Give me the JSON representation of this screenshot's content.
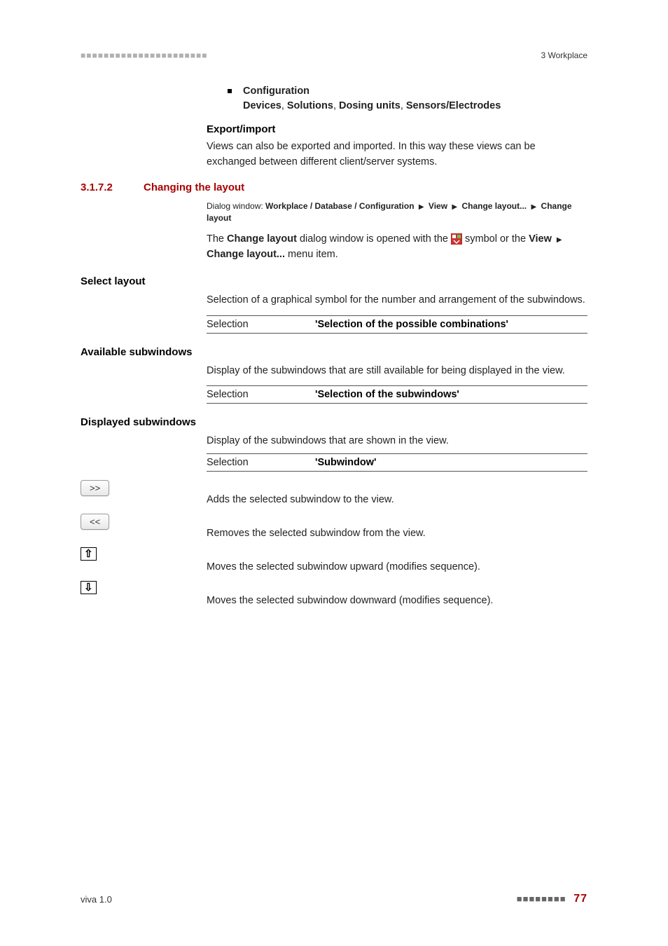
{
  "header": {
    "left_marks": "■■■■■■■■■■■■■■■■■■■■■■",
    "right": "3 Workplace"
  },
  "config_bullet": {
    "title": "Configuration",
    "line2_parts": [
      "Devices",
      "Solutions",
      "Dosing units",
      "Sensors/Electrodes"
    ]
  },
  "export_import": {
    "heading": "Export/import",
    "body": "Views can also be exported and imported. In this way these views can be exchanged between different client/server systems."
  },
  "section": {
    "number": "3.1.7.2",
    "title": "Changing the layout",
    "dialog_prefix": "Dialog window: ",
    "dialog_path1": "Workplace / Database / Configuration",
    "dialog_path2": "View",
    "dialog_path3": "Change layout...",
    "dialog_path4": "Change layout",
    "para_pre": "The ",
    "para_bold1": "Change layout",
    "para_mid": " dialog window is opened with the ",
    "para_post_icon": " symbol or the ",
    "para_bold2": "View",
    "para_bold3": "Change layout...",
    "para_end": " menu item."
  },
  "select_layout": {
    "heading": "Select layout",
    "body": "Selection of a graphical symbol for the number and arrangement of the subwindows.",
    "sel_label": "Selection",
    "sel_value": "'Selection of the possible combinations'"
  },
  "available": {
    "heading": "Available subwindows",
    "body": "Display of the subwindows that are still available for being displayed in the view.",
    "sel_label": "Selection",
    "sel_value": "'Selection of the subwindows'"
  },
  "displayed": {
    "heading": "Displayed subwindows",
    "body": "Display of the subwindows that are shown in the view.",
    "sel_label": "Selection",
    "sel_value": "'Subwindow'"
  },
  "buttons": {
    "add_label": ">>",
    "add_desc": "Adds the selected subwindow to the view.",
    "remove_label": "<<",
    "remove_desc": "Removes the selected subwindow from the view.",
    "up_desc": "Moves the selected subwindow upward (modifies sequence).",
    "down_desc": "Moves the selected subwindow downward (modifies sequence)."
  },
  "footer": {
    "left": "viva 1.0",
    "right_marks": "■■■■■■■■",
    "page": "77"
  }
}
